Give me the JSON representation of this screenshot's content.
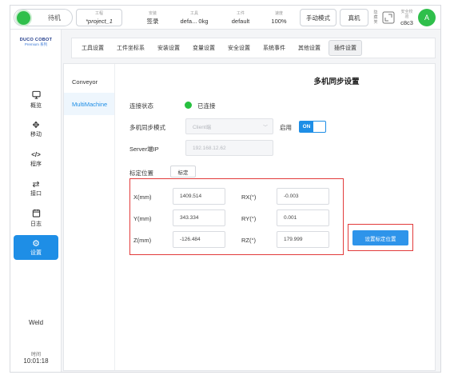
{
  "topbar": {
    "status_text": "待机",
    "project": {
      "caption": "工程",
      "value": "*project_1"
    },
    "install": {
      "caption": "安装",
      "value": "签录"
    },
    "tool": {
      "caption": "工具",
      "value": "defa... 0kg"
    },
    "workpiece": {
      "caption": "工件",
      "value": "default"
    },
    "speed": {
      "caption": "速度",
      "value": "100%"
    },
    "mode_button": "手动模式",
    "machine_button": "真机",
    "side_text": "隐\n藏\n笑",
    "safety": {
      "caption": "安全校\n验",
      "value": "c8c3"
    },
    "avatar": "A"
  },
  "sidebar": {
    "logo_main": "DUCO COBOT",
    "logo_sub": "Premium 系列",
    "items": [
      {
        "label": "概览",
        "icon": "monitor-icon"
      },
      {
        "label": "移动",
        "icon": "move-icon"
      },
      {
        "label": "程序",
        "icon": "code-icon"
      },
      {
        "label": "接口",
        "icon": "swap-icon"
      },
      {
        "label": "日志",
        "icon": "calendar-icon"
      },
      {
        "label": "设置",
        "icon": "gear-icon"
      }
    ],
    "weld": "Weld",
    "time_caption": "时间",
    "time_value": "10:01:18"
  },
  "tabs": [
    "工具设置",
    "工件坐标系",
    "安装设置",
    "变量设置",
    "安全设置",
    "系统事件",
    "其他设置",
    "插件设置"
  ],
  "sublist": [
    "Conveyor",
    "MultiMachine"
  ],
  "main": {
    "title": "多机同步设置",
    "conn_label": "连接状态",
    "conn_status": "已连接",
    "mode_label": "多机同步模式",
    "mode_value": "Client端",
    "enable_label": "启用",
    "toggle_on": "ON",
    "ip_label": "Server端IP",
    "ip_value": "192.168.12.62",
    "calib_label": "标定位置",
    "calib_button": "标定",
    "coords": {
      "x_label": "X(mm)",
      "x_value": "1409.514",
      "y_label": "Y(mm)",
      "y_value": "343.334",
      "z_label": "Z(mm)",
      "z_value": "-126.484",
      "rx_label": "RX(°)",
      "rx_value": "-0.003",
      "ry_label": "RY(°)",
      "ry_value": "0.001",
      "rz_label": "RZ(°)",
      "rz_value": "179.999"
    },
    "set_button": "设置标定位置"
  },
  "colors": {
    "accent": "#1e8ee6",
    "status_green": "#2fbf4b",
    "highlight_red": "#e23b3b"
  }
}
